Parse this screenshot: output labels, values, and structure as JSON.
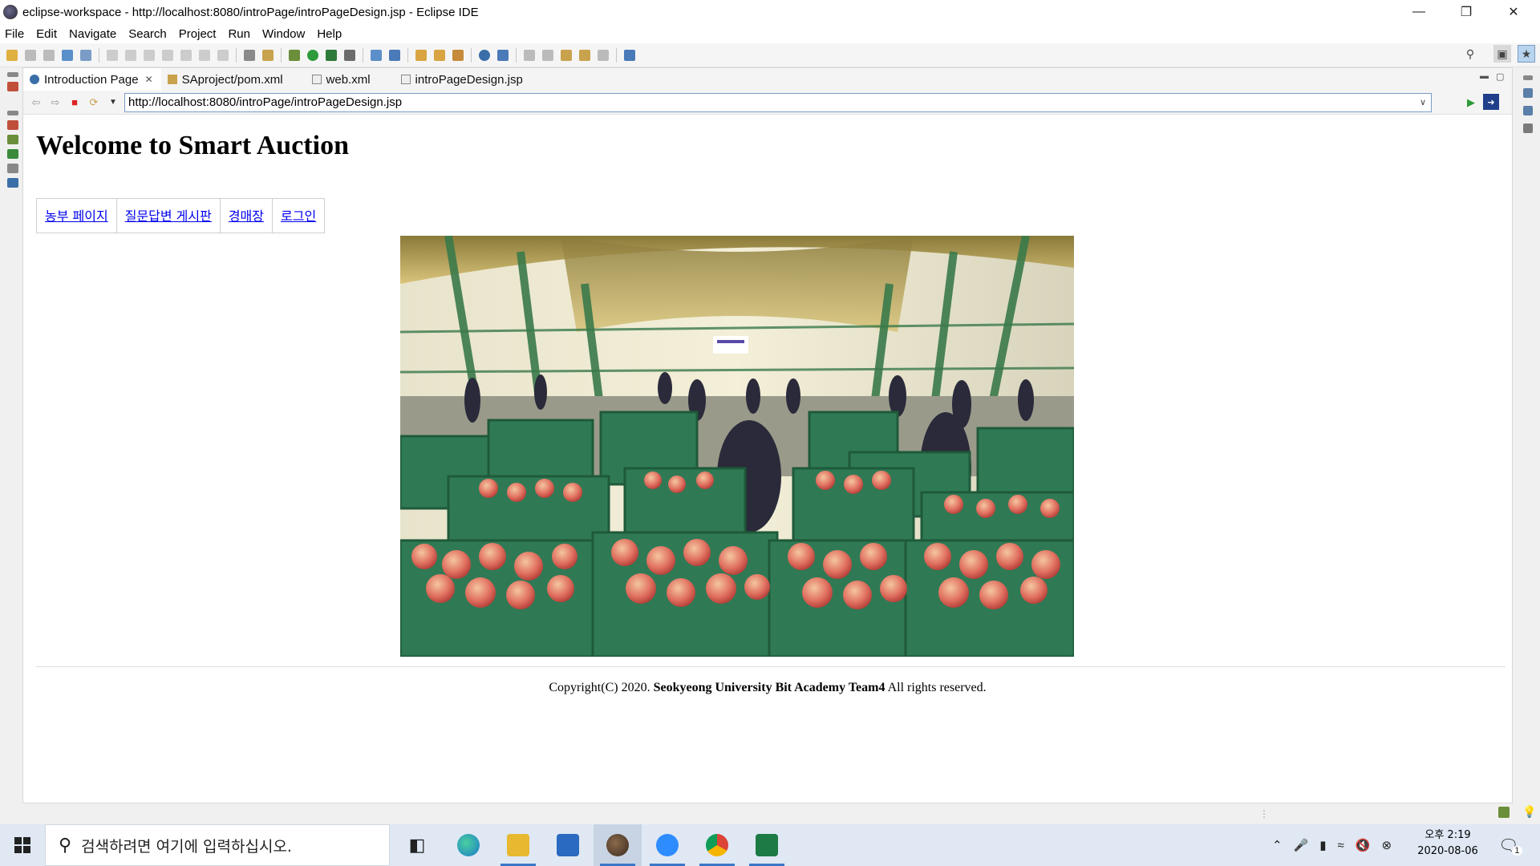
{
  "window": {
    "title": "eclipse-workspace - http://localhost:8080/introPage/introPageDesign.jsp - Eclipse IDE"
  },
  "menubar": {
    "items": [
      "File",
      "Edit",
      "Navigate",
      "Search",
      "Project",
      "Run",
      "Window",
      "Help"
    ]
  },
  "tabs": [
    {
      "label": "Introduction Page",
      "active": true,
      "icon": "globe-icon"
    },
    {
      "label": "SAproject/pom.xml",
      "active": false,
      "icon": "maven-file-icon"
    },
    {
      "label": "web.xml",
      "active": false,
      "icon": "xml-file-icon"
    },
    {
      "label": "introPageDesign.jsp",
      "active": false,
      "icon": "jsp-file-icon"
    }
  ],
  "browser": {
    "url": "http://localhost:8080/introPage/introPageDesign.jsp"
  },
  "page": {
    "heading": "Welcome to Smart Auction",
    "nav_links": [
      "농부 페이지",
      "질문답변 게시판",
      "경매장",
      "로그인"
    ],
    "footer_prefix": "Copyright(C) 2020. ",
    "footer_bold": "Seokyeong University Bit Academy Team4",
    "footer_suffix": " All rights reserved."
  },
  "taskbar": {
    "search_placeholder": "검색하려면 여기에 입력하십시오.",
    "clock_time": "오후 2:19",
    "clock_date": "2020-08-06",
    "notification_count": "1"
  },
  "colors": {
    "link": "#0000ee",
    "accent": "#3a77c9",
    "crate_green": "#2f7a55",
    "apple_red": "#d9534f"
  }
}
